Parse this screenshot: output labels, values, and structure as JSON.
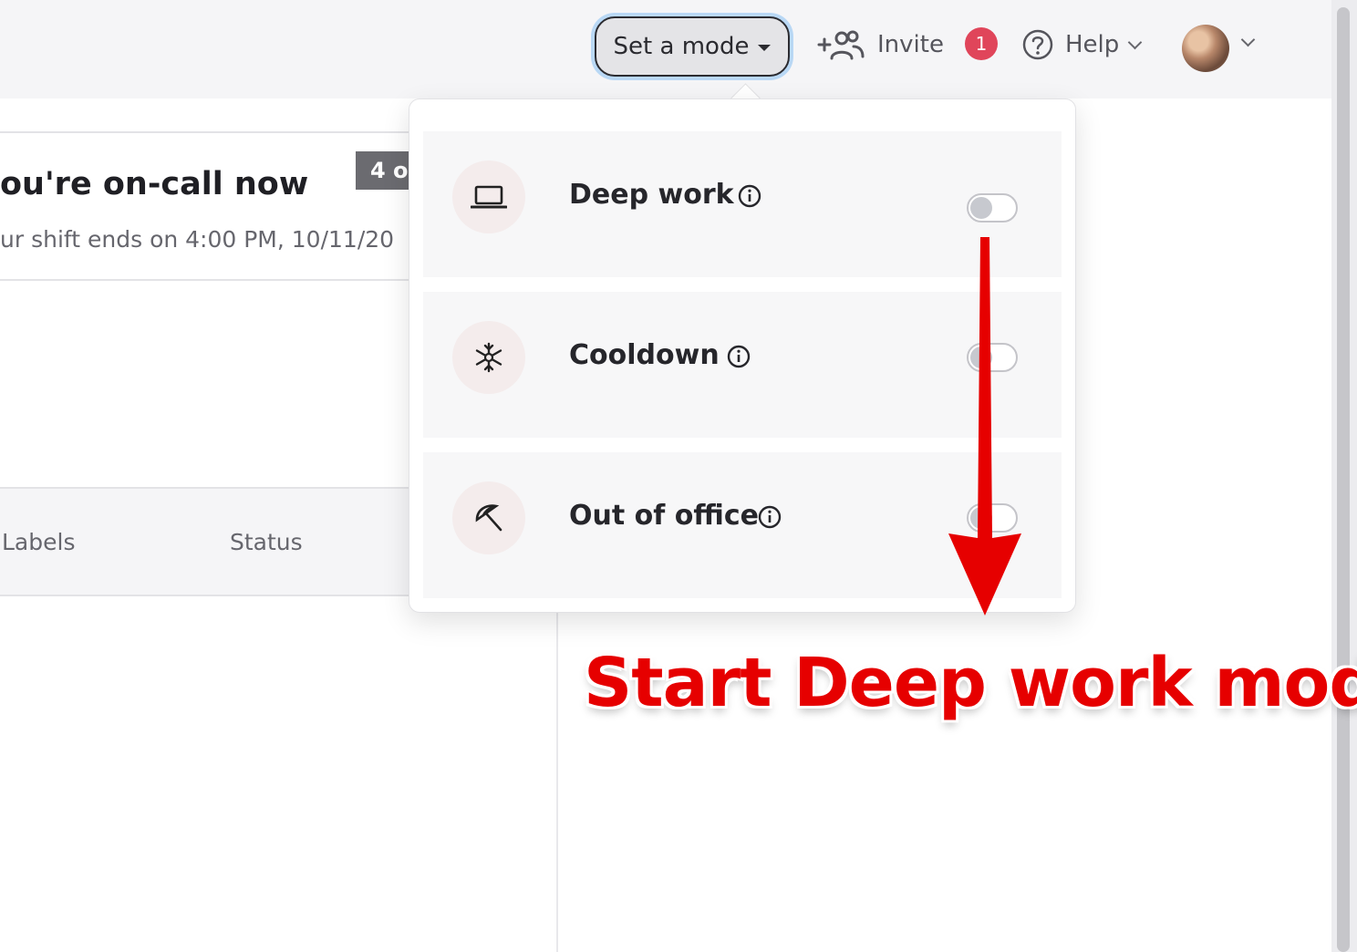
{
  "header": {
    "mode_button_label": "Set a mode",
    "invite_label": "Invite",
    "notification_count": "1",
    "help_label": "Help"
  },
  "oncall": {
    "title": "ou're on-call now",
    "subtitle": "ur shift ends on 4:00 PM, 10/11/20",
    "badge": "4 o"
  },
  "table": {
    "columns": [
      "Labels",
      "Status"
    ]
  },
  "modes": {
    "items": [
      {
        "label": "Deep work",
        "icon": "laptop-icon",
        "enabled": false
      },
      {
        "label": "Cooldown",
        "icon": "snowflake-icon",
        "enabled": false
      },
      {
        "label": "Out of office",
        "icon": "umbrella-icon",
        "enabled": false
      }
    ]
  },
  "annotation": {
    "text": "Start Deep work mode",
    "color": "#e60000"
  }
}
